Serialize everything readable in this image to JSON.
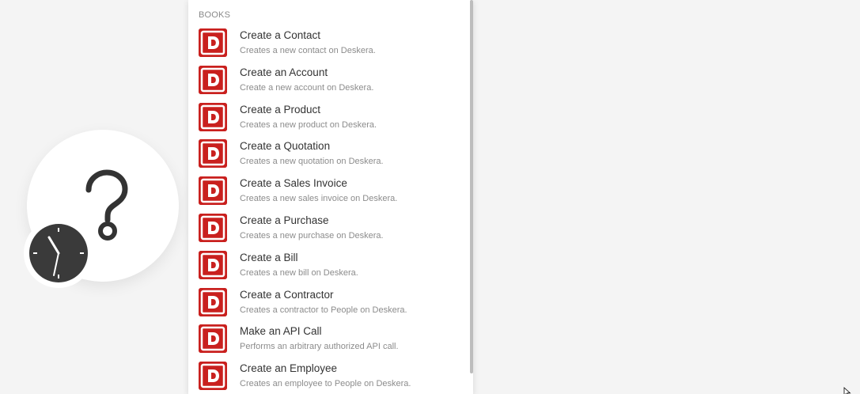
{
  "panel": {
    "section_header": "BOOKS",
    "items": [
      {
        "title": "Create a Contact",
        "description": "Creates a new contact on Deskera.",
        "icon": "deskera-icon"
      },
      {
        "title": "Create an Account",
        "description": "Create a new account on Deskera.",
        "icon": "deskera-icon"
      },
      {
        "title": "Create a Product",
        "description": "Creates a new product on Deskera.",
        "icon": "deskera-icon"
      },
      {
        "title": "Create a Quotation",
        "description": "Creates a new quotation on Deskera.",
        "icon": "deskera-icon"
      },
      {
        "title": "Create a Sales Invoice",
        "description": "Creates a new sales invoice on Deskera.",
        "icon": "deskera-icon"
      },
      {
        "title": "Create a Purchase",
        "description": "Creates a new purchase on Deskera.",
        "icon": "deskera-icon"
      },
      {
        "title": "Create a Bill",
        "description": "Creates a new bill on Deskera.",
        "icon": "deskera-icon"
      },
      {
        "title": "Create a Contractor",
        "description": "Creates a contractor to People on Deskera.",
        "icon": "deskera-icon"
      },
      {
        "title": "Make an API Call",
        "description": "Performs an arbitrary authorized API call.",
        "icon": "deskera-icon"
      },
      {
        "title": "Create an Employee",
        "description": "Creates an employee to People on Deskera.",
        "icon": "deskera-icon"
      }
    ]
  },
  "module": {
    "icons": [
      "question-mark-icon",
      "clock-icon"
    ]
  },
  "colors": {
    "brand": "#c9201e",
    "background": "#f4f4f4",
    "panel": "#ffffff",
    "title_text": "#333333",
    "desc_text": "#8c8c8c"
  }
}
